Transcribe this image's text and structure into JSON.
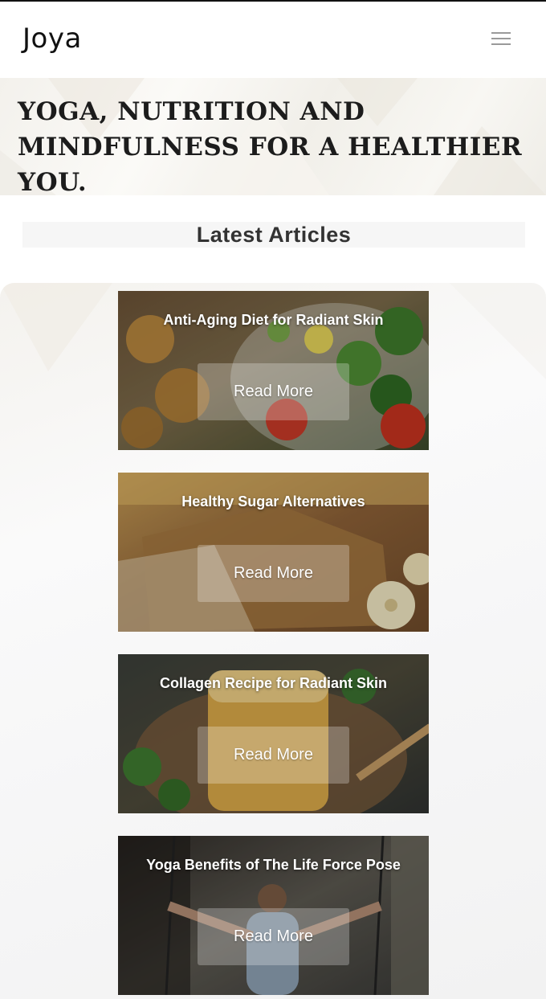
{
  "header": {
    "logo": "Joya",
    "menu_icon": "hamburger-menu-icon"
  },
  "hero": {
    "title": "YOGA, NUTRITION AND MINDFULNESS FOR A HEALTHIER YOU."
  },
  "articles": {
    "heading": "Latest Articles",
    "items": [
      {
        "title": "Anti-Aging Diet for Radiant Skin",
        "button": "Read More"
      },
      {
        "title": "Healthy Sugar Alternatives",
        "button": "Read More"
      },
      {
        "title": "Collagen Recipe for Radiant Skin",
        "button": "Read More"
      },
      {
        "title": "Yoga Benefits of The Life Force Pose",
        "button": "Read More"
      }
    ]
  },
  "colors": {
    "text_dark": "#1c1c1c",
    "button_overlay": "rgba(255,255,255,0.26)",
    "menu_icon": "#9a9a9a"
  }
}
